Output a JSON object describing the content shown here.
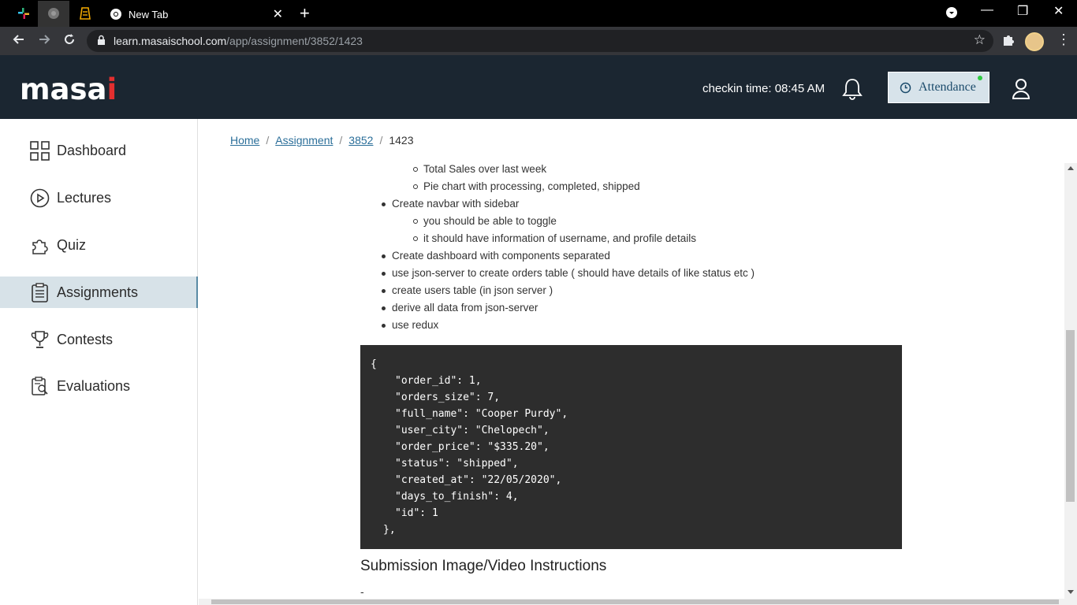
{
  "browser": {
    "tab_title": "New Tab",
    "url_host": "learn.masaischool.com",
    "url_path": "/app/assignment/3852/1423"
  },
  "header": {
    "logo_main": "masa",
    "logo_accent": "i",
    "checkin_text": "checkin time: 08:45 AM",
    "attendance_label": "Attendance",
    "brand_color": "#1b2631",
    "accent_color": "#e32f2f"
  },
  "sidebar": {
    "items": [
      {
        "label": "Dashboard",
        "icon": "grid-icon"
      },
      {
        "label": "Lectures",
        "icon": "play-circle-icon"
      },
      {
        "label": "Quiz",
        "icon": "puzzle-icon"
      },
      {
        "label": "Assignments",
        "icon": "clipboard-icon"
      },
      {
        "label": "Contests",
        "icon": "trophy-icon"
      },
      {
        "label": "Evaluations",
        "icon": "evaluation-icon"
      }
    ],
    "active_index": 3
  },
  "breadcrumb": {
    "items": [
      "Home",
      "Assignment",
      "3852"
    ],
    "current": "1423",
    "separator": "/"
  },
  "content": {
    "list": [
      "Total Sales over last week",
      "Pie chart with processing, completed, shipped",
      "Create navbar with sidebar",
      "you should be able to toggle",
      "it should have information of username, and profile details",
      "Create dashboard with components separated",
      "use json-server to create orders table ( should have details of like status etc )",
      "create users table (in json server )",
      "derive all data from json-server",
      "use redux"
    ],
    "code_lines": [
      "{",
      "\"order_id\": 1,",
      "\"orders_size\": 7,",
      "\"full_name\": \"Cooper Purdy\",",
      "\"user_city\": \"Chelopech\",",
      "\"order_price\": \"$335.20\",",
      "\"status\": \"shipped\",",
      "\"created_at\": \"22/05/2020\",",
      "\"days_to_finish\": 4,",
      "\"id\": 1",
      "},"
    ],
    "submission_heading": "Submission Image/Video Instructions",
    "submission_text": "-"
  }
}
